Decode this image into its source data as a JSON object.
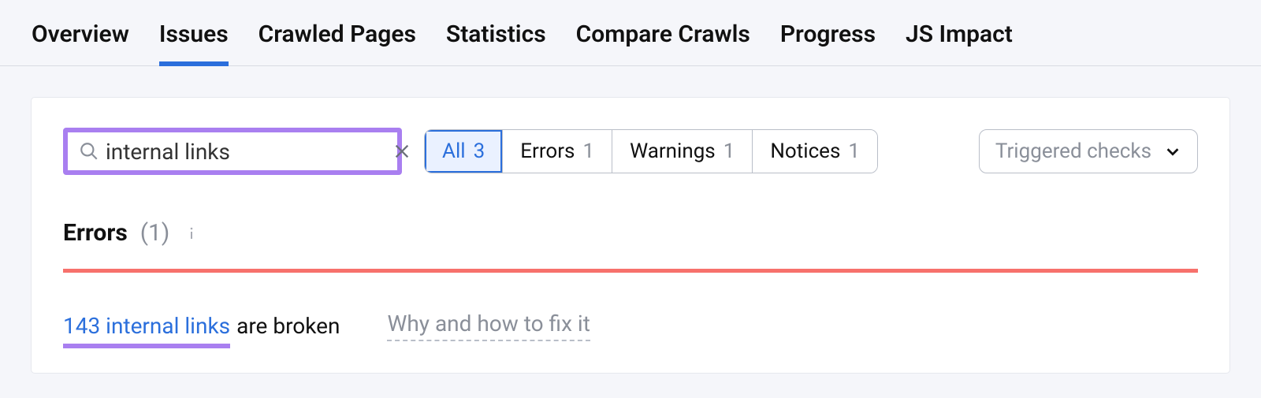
{
  "tabs": {
    "overview": "Overview",
    "issues": "Issues",
    "crawled_pages": "Crawled Pages",
    "statistics": "Statistics",
    "compare_crawls": "Compare Crawls",
    "progress": "Progress",
    "js_impact": "JS Impact",
    "active": "issues"
  },
  "search": {
    "value": "internal links"
  },
  "filters": {
    "all": {
      "label": "All",
      "count": "3"
    },
    "errors": {
      "label": "Errors",
      "count": "1"
    },
    "warnings": {
      "label": "Warnings",
      "count": "1"
    },
    "notices": {
      "label": "Notices",
      "count": "1"
    }
  },
  "dropdown": {
    "label": "Triggered checks"
  },
  "section": {
    "errors_label": "Errors",
    "errors_count": "(1)"
  },
  "issue": {
    "link_text": "143 internal links",
    "tail_text": "are broken",
    "why_text": "Why and how to fix it"
  }
}
